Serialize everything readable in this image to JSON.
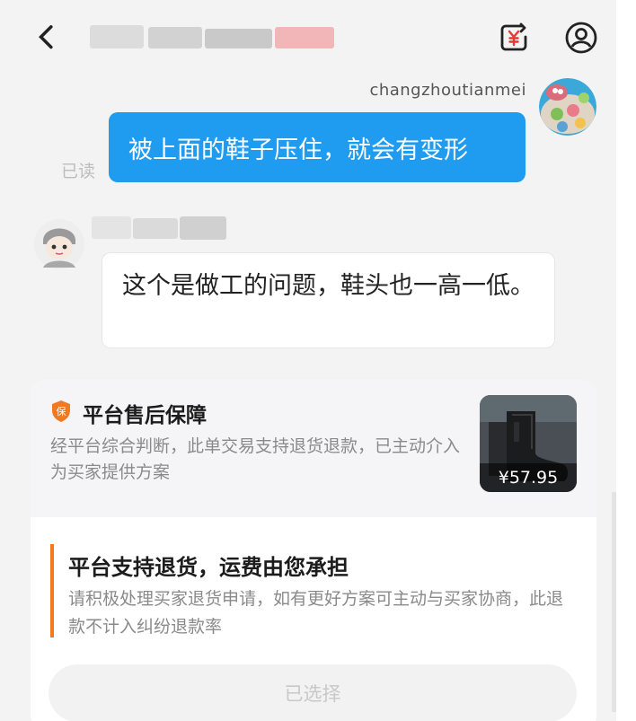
{
  "conversation": {
    "sender_name": "changzhoutianmei",
    "read_label": "已读",
    "messages": [
      {
        "from": "me",
        "text": "被上面的鞋子压住，就会有变形"
      },
      {
        "from": "other",
        "text": "这个是做工的问题，鞋头也一高一低。"
      }
    ]
  },
  "card": {
    "title": "平台售后保障",
    "badge_icon": "shield-icon",
    "badge_char": "保",
    "description": "经平台综合判断，此单交易支持退货退款，已主动介入为买家提供方案",
    "product_price": "¥57.95",
    "option": {
      "title": "平台支持退货，运费由您承担",
      "description": "请积极处理买家退货申请，如有更好方案可主动与买家协商，此退款不计入纠纷退款率"
    },
    "button_label": "已选择"
  },
  "colors": {
    "bubble_blue": "#1f9cf0",
    "accent_orange": "#f07a22"
  }
}
